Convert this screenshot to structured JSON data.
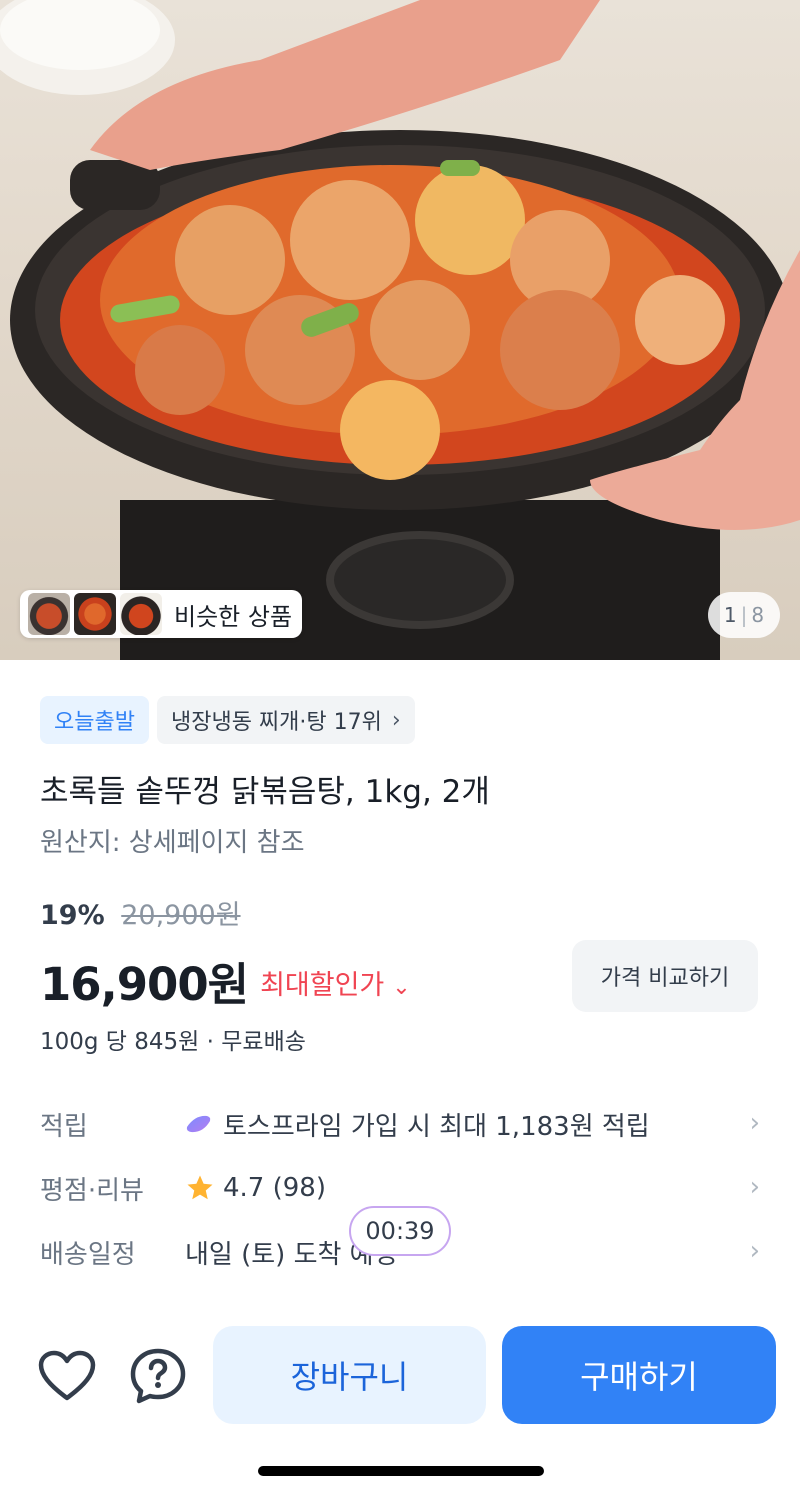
{
  "hero": {
    "similar_label": "비슷한 상품",
    "pager_current": "1",
    "pager_total": "8"
  },
  "tags": {
    "today_ship": "오늘출발",
    "ranking": "냉장냉동 찌개·탕 17위"
  },
  "product": {
    "title": "초록들 솥뚜껑 닭볶음탕, 1kg, 2개",
    "origin": "원산지: 상세페이지 참조",
    "discount_pct": "19%",
    "original_price": "20,900원",
    "price": "16,900원",
    "max_discount_label": "최대할인가",
    "compare_button": "가격 비교하기",
    "unit_info": "100g 당 845원 · 무료배송"
  },
  "info_rows": {
    "points": {
      "label": "적립",
      "value": "토스프라임 가입 시 최대 1,183원 적립"
    },
    "rating": {
      "label": "평점·리뷰",
      "value": "4.7 (98)"
    },
    "delivery": {
      "label": "배송일정",
      "value": "내일 (토) 도착 예정"
    }
  },
  "timer": "00:39",
  "actions": {
    "cart": "장바구니",
    "buy": "구매하기"
  },
  "colors": {
    "primary": "#3182f6",
    "discount_red": "#f04452",
    "star": "#ffb331"
  },
  "icons": {
    "wishlist": "heart-icon",
    "inquiry": "question-bubble-icon",
    "rating": "star-icon",
    "prime": "toss-prime-icon"
  }
}
